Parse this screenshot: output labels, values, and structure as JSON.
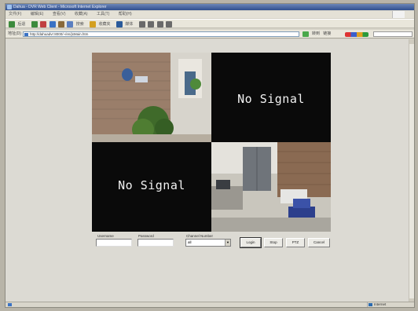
{
  "window": {
    "title": "Dahua - DVR Web Client - Microsoft Internet Explorer"
  },
  "menubar": {
    "items": [
      "文件(F)",
      "编辑(E)",
      "查看(V)",
      "收藏(A)",
      "工具(T)",
      "帮助(H)"
    ]
  },
  "toolbar": {
    "back_label": "后退",
    "search_label": "搜索",
    "favorites_label": "收藏夹",
    "media_label": "媒体"
  },
  "addressbar": {
    "label": "地址(D)",
    "url": "http://dahuadvr:8000/~/en/jsMain.htm",
    "go_label": "转到",
    "links_label": "链接"
  },
  "video": {
    "channels": [
      {
        "id": 1,
        "status": "live",
        "text": ""
      },
      {
        "id": 2,
        "status": "no-signal",
        "text": "No Signal"
      },
      {
        "id": 3,
        "status": "no-signal",
        "text": "No Signal"
      },
      {
        "id": 4,
        "status": "live",
        "text": ""
      }
    ]
  },
  "controls": {
    "username_label": "Username",
    "username_value": "",
    "password_label": "Password",
    "password_value": "",
    "channel_label": "Channel Number",
    "channel_value": "all",
    "buttons": [
      "Login",
      "Stop",
      "PTZ",
      "Cancel"
    ]
  },
  "statusbar": {
    "text": "",
    "zone": "Internet"
  },
  "colors": {
    "titlebar": "#2f4f8f",
    "content_bg": "#dcdad3",
    "video_bg": "#0a0a0a",
    "no_signal_text": "#f2f2f2"
  }
}
